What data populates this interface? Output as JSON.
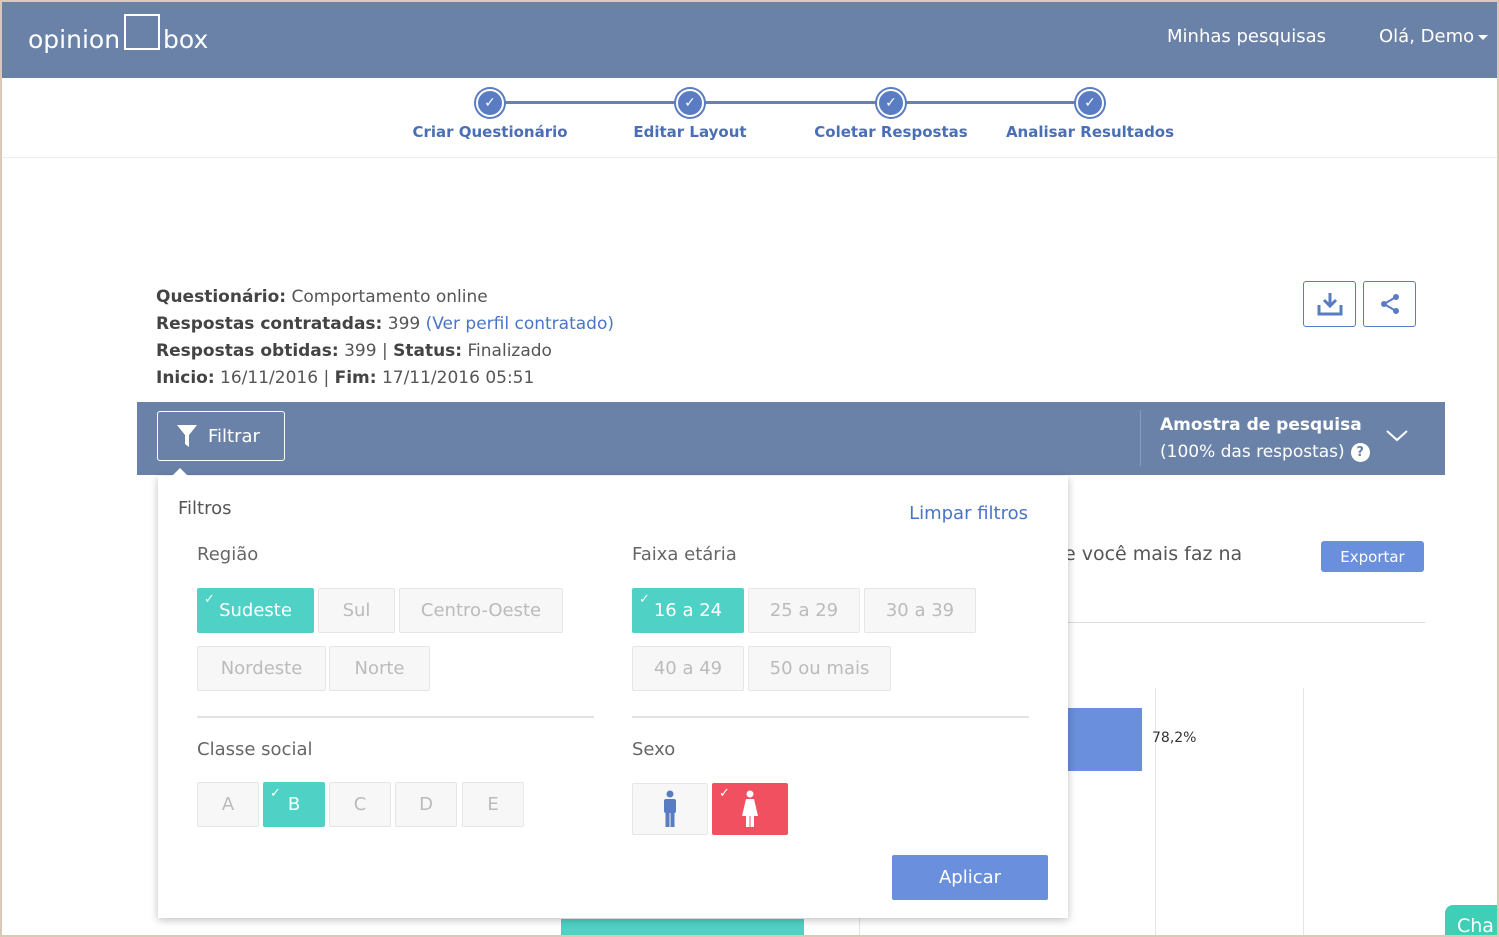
{
  "header": {
    "logo_left": "opinion",
    "logo_right": "box",
    "my_surveys": "Minhas pesquisas",
    "user_greeting": "Olá, Demo"
  },
  "stepper": {
    "steps": [
      {
        "label": "Criar Questionário",
        "done": true
      },
      {
        "label": "Editar Layout",
        "done": true
      },
      {
        "label": "Coletar Respostas",
        "done": true
      },
      {
        "label": "Analisar Resultados",
        "done": true
      }
    ],
    "check": "✓"
  },
  "info": {
    "questionnaire_label": "Questionário:",
    "questionnaire_value": "Comportamento online",
    "contracted_label": "Respostas contratadas:",
    "contracted_value": "399",
    "contracted_link": "(Ver perfil contratado)",
    "obtained_label": "Respostas obtidas:",
    "obtained_value": "399",
    "status_label": "Status:",
    "status_value": "Finalizado",
    "start_label": "Inicio:",
    "start_value": "16/11/2016",
    "end_label": "Fim:",
    "end_value": "17/11/2016 05:51",
    "separator": "|"
  },
  "toolbar": {
    "filter_label": "Filtrar",
    "sample_title": "Amostra de pesquisa",
    "sample_sub": "(100% das respostas)",
    "help": "?"
  },
  "filters": {
    "title": "Filtros",
    "clear": "Limpar filtros",
    "region": {
      "title": "Região",
      "options": [
        {
          "label": "Sudeste",
          "selected": true
        },
        {
          "label": "Sul",
          "selected": false
        },
        {
          "label": "Centro-Oeste",
          "selected": false
        },
        {
          "label": "Nordeste",
          "selected": false
        },
        {
          "label": "Norte",
          "selected": false
        }
      ]
    },
    "age": {
      "title": "Faixa etária",
      "options": [
        {
          "label": "16 a 24",
          "selected": true
        },
        {
          "label": "25 a 29",
          "selected": false
        },
        {
          "label": "30 a 39",
          "selected": false
        },
        {
          "label": "40 a 49",
          "selected": false
        },
        {
          "label": "50 ou mais",
          "selected": false
        }
      ]
    },
    "social_class": {
      "title": "Classe social",
      "options": [
        {
          "label": "A",
          "selected": false
        },
        {
          "label": "B",
          "selected": true
        },
        {
          "label": "C",
          "selected": false
        },
        {
          "label": "D",
          "selected": false
        },
        {
          "label": "E",
          "selected": false
        }
      ]
    },
    "sex": {
      "title": "Sexo",
      "options": [
        {
          "icon": "male-icon",
          "selected": false
        },
        {
          "icon": "female-icon",
          "selected": true
        }
      ]
    },
    "apply": "Aplicar"
  },
  "background": {
    "question_fragment": "e você mais faz na",
    "export": "Exportar",
    "bar_value": "78,2%",
    "chat": "Cha"
  },
  "colors": {
    "header": "#6b82a8",
    "accent": "#5a7cc2",
    "selected_teal": "#4fd1c5",
    "selected_red": "#f0505f",
    "link": "#4a74c9"
  }
}
